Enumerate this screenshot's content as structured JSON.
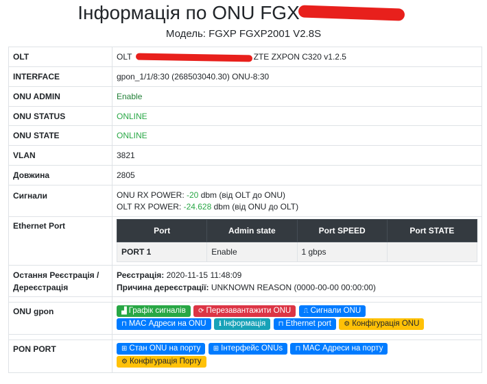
{
  "page": {
    "title": "Інформація по ONU FGX",
    "subtitle": "Модель: FGXP FGXP2001 V2.8S"
  },
  "rows": {
    "olt": {
      "key": "OLT",
      "prefix": "OLT ",
      "suffix": "ZTE ZXPON C320 v1.2.5"
    },
    "interface": {
      "key": "INTERFACE",
      "value": "gpon_1/1/8:30 (268503040.30) ONU-8:30"
    },
    "onu_admin": {
      "key": "ONU ADMIN",
      "value": "Enable"
    },
    "onu_status": {
      "key": "ONU STATUS",
      "value": "ONLINE"
    },
    "onu_state": {
      "key": "ONU STATE",
      "value": "ONLINE"
    },
    "vlan": {
      "key": "VLAN",
      "value": "3821"
    },
    "length": {
      "key": "Довжина",
      "value": "2805"
    },
    "signals": {
      "key": "Сигнали",
      "onu_rx_label": "ONU RX POWER: ",
      "onu_rx_value": "-20",
      "onu_rx_suffix": " dbm (від OLT до ONU)",
      "olt_rx_label": "OLT RX POWER: ",
      "olt_rx_value": "-24.628",
      "olt_rx_suffix": " dbm (від ONU до OLT)"
    },
    "ethernet": {
      "key": "Ethernet Port",
      "headers": [
        "Port",
        "Admin state",
        "Port SPEED",
        "Port STATE"
      ],
      "rows": [
        {
          "port": "PORT 1",
          "admin": "Enable",
          "speed": "1 gbps",
          "state": ""
        }
      ]
    },
    "registration": {
      "key": "Остання Реєстрація / Дереєстрація",
      "reg_label": "Реєстрація:",
      "reg_value": " 2020-11-15 11:48:09",
      "dereg_label": "Причина дереєстрації:",
      "dereg_value": " UNKNOWN REASON (0000-00-00 00:00:00)"
    },
    "onu_gpon": {
      "key": "ONU gpon",
      "buttons": [
        {
          "label": "Графік сигналів",
          "icon": "chart-icon",
          "glyph": "📈"
        },
        {
          "label": "Перезавантажити ONU",
          "icon": "refresh-icon",
          "glyph": "⟳"
        },
        {
          "label": "Сигнали ONU",
          "icon": "signal-icon",
          "glyph": "⎍"
        },
        {
          "label": "MAC Адреси на ONU",
          "icon": "ethernet-icon",
          "glyph": "⊓"
        },
        {
          "label": "Інформація",
          "icon": "info-icon",
          "glyph": "ℹ"
        },
        {
          "label": "Ethernet port",
          "icon": "ethernet-icon",
          "glyph": "⊓"
        },
        {
          "label": "Конфігурація ONU",
          "icon": "gears-icon",
          "glyph": "⚙"
        }
      ]
    },
    "pon_port": {
      "key": "PON PORT",
      "buttons": [
        {
          "label": "Стан ONU на порту",
          "icon": "sitemap-icon",
          "glyph": "⊞"
        },
        {
          "label": "Інтерфейс ONUs",
          "icon": "sitemap-icon",
          "glyph": "⊞"
        },
        {
          "label": "MAC Адреси на порту",
          "icon": "ethernet-icon",
          "glyph": "⊓"
        },
        {
          "label": "Конфігурація Порту",
          "icon": "gears-icon",
          "glyph": "⚙"
        }
      ]
    }
  },
  "colors": {
    "success": "#28a745",
    "danger": "#dc3545",
    "primary": "#007bff",
    "info": "#17a2b8",
    "warning": "#ffc107",
    "table_header": "#343a40",
    "redaction": "#e8201c"
  }
}
